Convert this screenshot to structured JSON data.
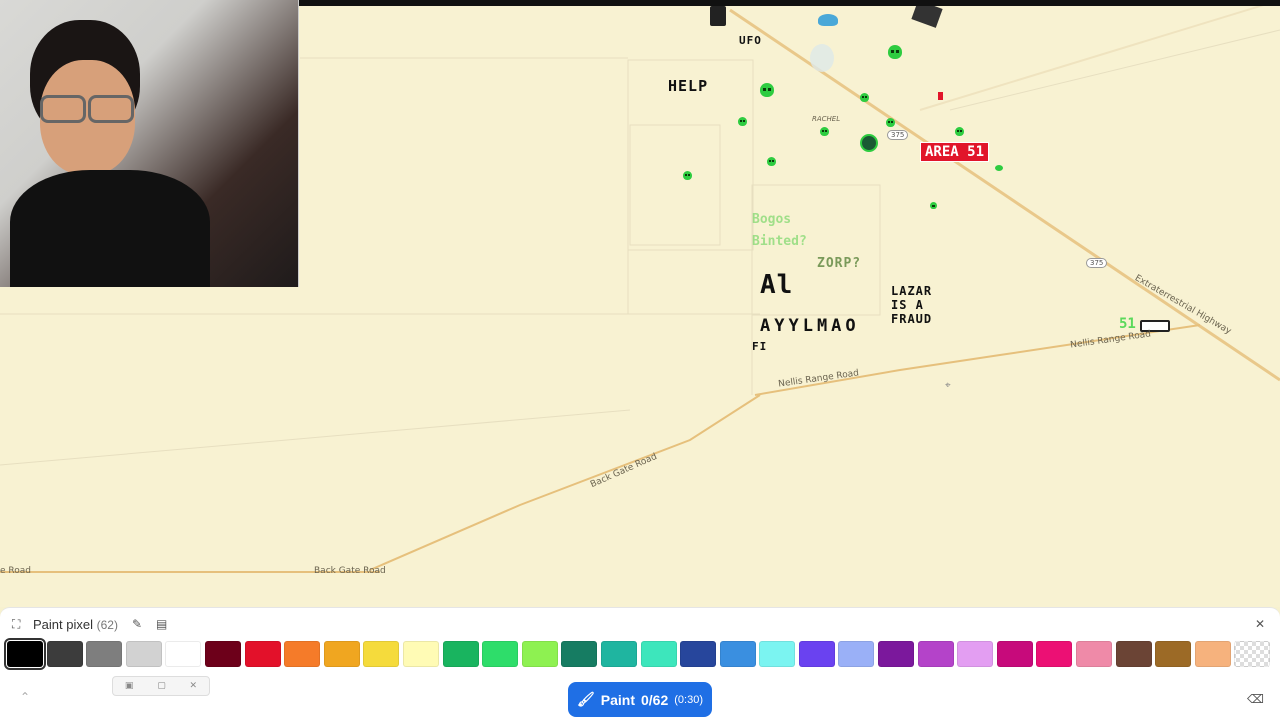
{
  "map": {
    "labels": {
      "ufo": "UFO",
      "help": "HELP",
      "rachel": "RACHEL",
      "area51": "AREA 51",
      "bogos": "Bogos",
      "binted": "Binted?",
      "zorp": "ZORP?",
      "al": "Al",
      "lazar1": "LAZAR",
      "lazar2": "IS A",
      "lazar3": "FRAUD",
      "ayylmao": "AYYLMAO",
      "fi": "FI",
      "fiftyone": "51",
      "shield375a": "375",
      "shield375b": "375",
      "nellis1": "Nellis Range Road",
      "nellis2": "Nellis Range Road",
      "extraterrestrial": "Extraterrestrial Highway",
      "backgate1": "Back Gate Road",
      "backgate2": "Back Gate Road",
      "backgate3": "e Road"
    }
  },
  "toolbar": {
    "title": "Paint pixel",
    "count": "(62)",
    "paint_label": "Paint",
    "paint_progress": "0/62",
    "paint_timer": "(0:30)"
  },
  "palette": [
    "#000000",
    "#3c3c3c",
    "#7e7e7e",
    "#d2d2d2",
    "#ffffff",
    "#6d001a",
    "#e3112a",
    "#f57b29",
    "#f0a620",
    "#f5db3c",
    "#fffbb5",
    "#19b45f",
    "#2edd6a",
    "#8ef151",
    "#167c62",
    "#1fb5a0",
    "#3de6bc",
    "#27469c",
    "#3a8fe0",
    "#7bf4f1",
    "#6a42f0",
    "#9ab0f7",
    "#7b189c",
    "#b443c9",
    "#e39ef2",
    "#c70a7b",
    "#ec1074",
    "#ef8aa8",
    "#6b4435",
    "#9c6a26",
    "#f6b27d",
    "#eeeeee"
  ],
  "selected_color_index": 0
}
